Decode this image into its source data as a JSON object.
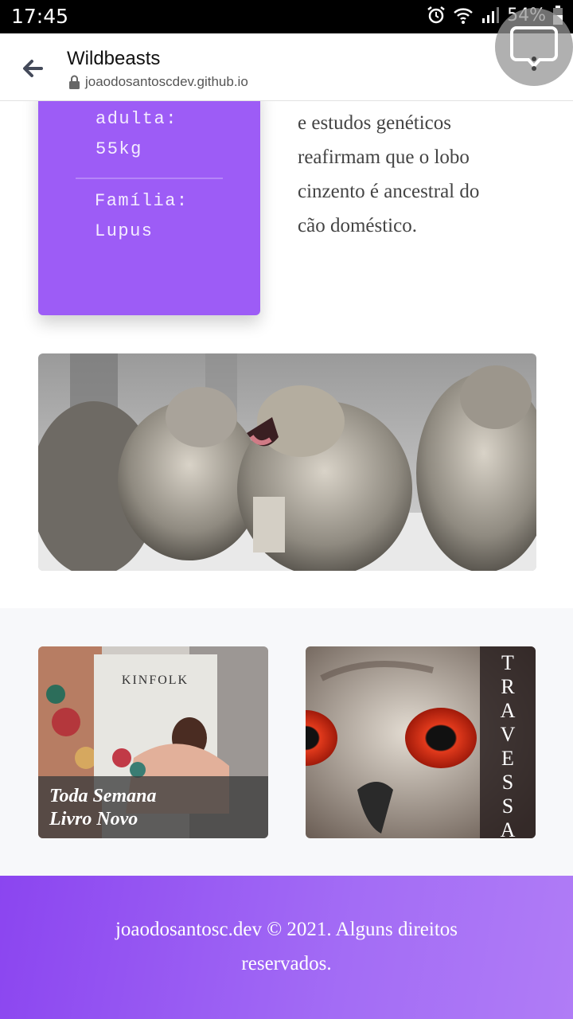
{
  "status_bar": {
    "time": "17:45",
    "battery": "54%",
    "icons": [
      "alarm-icon",
      "wifi-icon",
      "signal-icon",
      "battery-icon"
    ]
  },
  "browser": {
    "title": "Wildbeasts",
    "url": "joaodosantoscdev.github.io",
    "icons": [
      "back-arrow-icon",
      "lock-icon",
      "assistant-bubble-icon"
    ]
  },
  "fact_card": {
    "line1": "adulta:",
    "line2": "55kg",
    "line3": "Família:",
    "line4": "Lupus"
  },
  "article": {
    "lines": [
      "e estudos genéticos",
      "reafirmam que o lobo",
      "cinzento é ancestral do",
      "cão doméstico."
    ]
  },
  "promo": {
    "book_caption_line1": "Toda Semana",
    "book_caption_line2": "Livro Novo",
    "book_title": "KINFOLK",
    "owl_label": "TRAVESSA"
  },
  "footer": {
    "text": "joaodosantosc.dev © 2021. Alguns direitos reservados."
  },
  "colors": {
    "accent_purple": "#9d5cf6",
    "footer_gradient_start": "#8b45f0",
    "footer_gradient_end": "#b07cf6",
    "band_gray": "#f7f8fa"
  }
}
